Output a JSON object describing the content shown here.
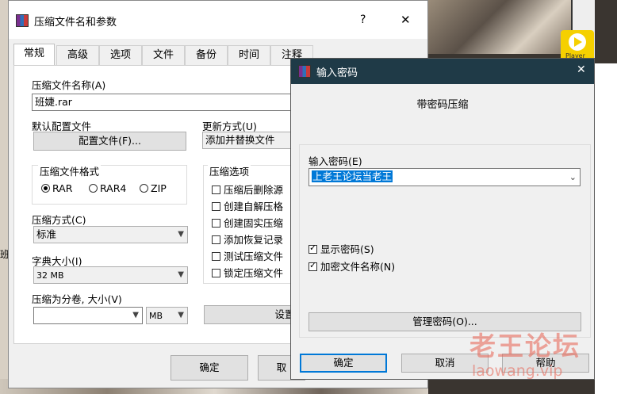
{
  "main_window": {
    "title": "压缩文件名和参数",
    "help_glyph": "?",
    "close_glyph": "✕",
    "tabs": [
      "常规",
      "高级",
      "选项",
      "文件",
      "备份",
      "时间",
      "注释"
    ],
    "archive_name_label": "压缩文件名称(A)",
    "archive_name_value": "班婕.rar",
    "default_profile_label": "默认配置文件",
    "profile_button": "配置文件(F)...",
    "update_mode_label": "更新方式(U)",
    "update_mode_value": "添加并替换文件",
    "format_group_label": "压缩文件格式",
    "formats": [
      {
        "label": "RAR",
        "selected": true
      },
      {
        "label": "RAR4",
        "selected": false
      },
      {
        "label": "ZIP",
        "selected": false
      }
    ],
    "options_group_label": "压缩选项",
    "options": [
      {
        "label": "压缩后删除源",
        "checked": false
      },
      {
        "label": "创建自解压格",
        "checked": false
      },
      {
        "label": "创建固实压缩",
        "checked": false
      },
      {
        "label": "添加恢复记录",
        "checked": false
      },
      {
        "label": "测试压缩文件",
        "checked": false
      },
      {
        "label": "锁定压缩文件",
        "checked": false
      }
    ],
    "method_label": "压缩方式(C)",
    "method_value": "标准",
    "dict_label": "字典大小(I)",
    "dict_value": "32 MB",
    "split_label": "压缩为分卷, 大小(V)",
    "split_value": "",
    "split_unit": "MB",
    "set_password_button": "设置密",
    "ok_button": "确定",
    "cancel_button_partial": "取"
  },
  "password_dialog": {
    "title": "输入密码",
    "close_glyph": "✕",
    "heading": "带密码压缩",
    "enter_password_label": "输入密码(E)",
    "password_value": "上老王论坛当老王",
    "show_password_label": "显示密码(S)",
    "show_password_checked": true,
    "encrypt_names_label": "加密文件名称(N)",
    "encrypt_names_checked": true,
    "manage_button": "管理密码(O)...",
    "ok_button": "确定",
    "cancel_button": "取消",
    "help_button": "帮助"
  },
  "background": {
    "player_label": "Player",
    "side_char": "班"
  },
  "watermark": {
    "line1": "老王论坛",
    "line2": "laowang.vip"
  },
  "colors": {
    "accent": "#0078d7",
    "selection": "#0078d7",
    "watermark": "#e86050"
  }
}
